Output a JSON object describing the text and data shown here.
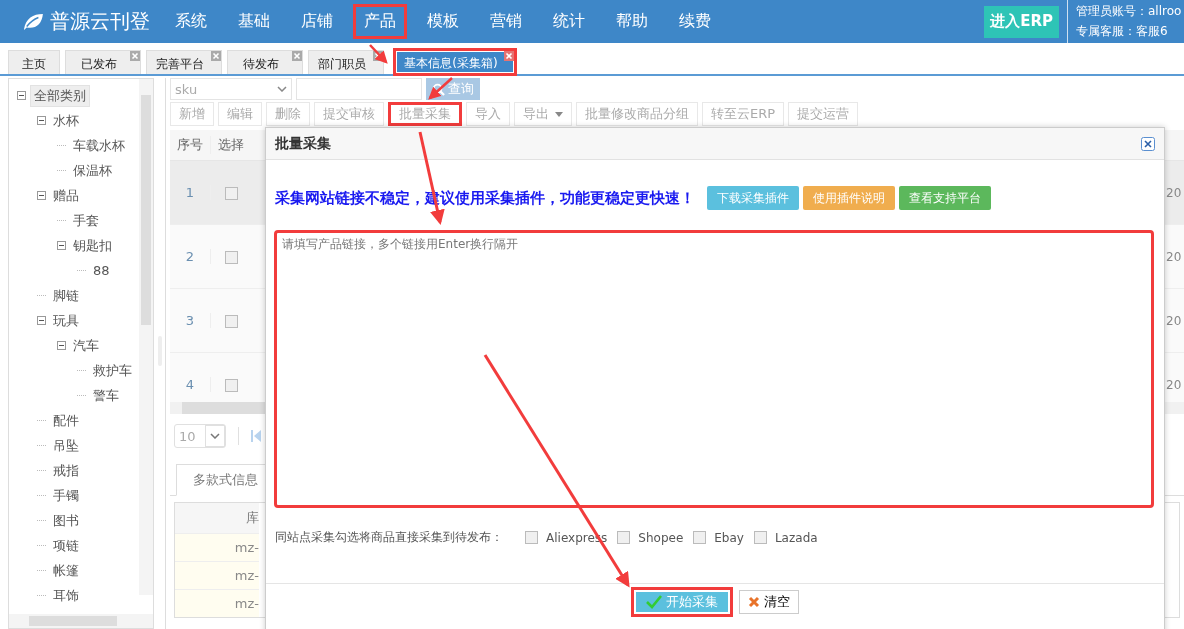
{
  "header": {
    "logo": "普源云刊登",
    "nav": [
      {
        "label": "系统",
        "highlighted": false
      },
      {
        "label": "基础",
        "highlighted": false
      },
      {
        "label": "店铺",
        "highlighted": false
      },
      {
        "label": "产品",
        "highlighted": true
      },
      {
        "label": "模板",
        "highlighted": false
      },
      {
        "label": "营销",
        "highlighted": false
      },
      {
        "label": "统计",
        "highlighted": false
      },
      {
        "label": "帮助",
        "highlighted": false
      },
      {
        "label": "续费",
        "highlighted": false
      }
    ],
    "erp_button": "进入ERP",
    "account": "管理员账号：allroo",
    "support": "专属客服：客服6"
  },
  "tabs": [
    {
      "label": "主页",
      "selected": false,
      "closable": false,
      "highlighted": false
    },
    {
      "label": "已发布",
      "selected": false,
      "closable": true,
      "highlighted": false
    },
    {
      "label": "完善平台",
      "selected": false,
      "closable": true,
      "highlighted": false
    },
    {
      "label": "待发布",
      "selected": false,
      "closable": true,
      "highlighted": false
    },
    {
      "label": "部门职员",
      "selected": false,
      "closable": true,
      "highlighted": false
    },
    {
      "label": "基本信息(采集箱)",
      "selected": true,
      "closable": true,
      "highlighted": true
    }
  ],
  "tree": [
    {
      "label": "全部类别",
      "selected": true,
      "expanded": true,
      "children": [
        {
          "label": "水杯",
          "selected": false,
          "expanded": true,
          "children": [
            {
              "label": "车载水杯",
              "selected": false
            },
            {
              "label": "保温杯",
              "selected": false
            }
          ]
        },
        {
          "label": "赠品",
          "selected": false,
          "expanded": true,
          "children": [
            {
              "label": "手套",
              "selected": false
            },
            {
              "label": "钥匙扣",
              "selected": false,
              "expanded": true,
              "children": [
                {
                  "label": "88",
                  "selected": false
                }
              ]
            }
          ]
        },
        {
          "label": "脚链",
          "selected": false
        },
        {
          "label": "玩具",
          "selected": false,
          "expanded": true,
          "children": [
            {
              "label": "汽车",
              "selected": false,
              "expanded": true,
              "children": [
                {
                  "label": "救护车",
                  "selected": false
                },
                {
                  "label": "警车",
                  "selected": false
                }
              ]
            }
          ]
        },
        {
          "label": "配件",
          "selected": false
        },
        {
          "label": "吊坠",
          "selected": false
        },
        {
          "label": "戒指",
          "selected": false
        },
        {
          "label": "手镯",
          "selected": false
        },
        {
          "label": "图书",
          "selected": false
        },
        {
          "label": "项链",
          "selected": false
        },
        {
          "label": "帐篷",
          "selected": false
        },
        {
          "label": "耳饰",
          "selected": false
        }
      ]
    }
  ],
  "search": {
    "field": "sku",
    "button": "查询"
  },
  "toolbar": [
    {
      "label": "新增",
      "highlighted": false,
      "dropdown": false
    },
    {
      "label": "编辑",
      "highlighted": false,
      "dropdown": false
    },
    {
      "label": "删除",
      "highlighted": false,
      "dropdown": false
    },
    {
      "label": "提交审核",
      "highlighted": false,
      "dropdown": false
    },
    {
      "label": "批量采集",
      "highlighted": true,
      "dropdown": false
    },
    {
      "label": "导入",
      "highlighted": false,
      "dropdown": false
    },
    {
      "label": "导出",
      "highlighted": false,
      "dropdown": true
    },
    {
      "label": "批量修改商品分组",
      "highlighted": false,
      "dropdown": false
    },
    {
      "label": "转至云ERP",
      "highlighted": false,
      "dropdown": false
    },
    {
      "label": "提交运营",
      "highlighted": false,
      "dropdown": false
    }
  ],
  "table": {
    "columns": [
      "序号",
      "选择"
    ],
    "rows": [
      {
        "index": "1",
        "checked": false,
        "selected": true,
        "column_3": "20"
      },
      {
        "index": "2",
        "checked": false,
        "selected": false,
        "column_3": "20"
      },
      {
        "index": "3",
        "checked": false,
        "selected": false,
        "column_3": "20"
      },
      {
        "index": "4",
        "checked": false,
        "selected": false,
        "column_3": "20"
      }
    ]
  },
  "pager": {
    "page_size": "10"
  },
  "detail_tabs": [
    {
      "label": "多款式信息",
      "selected": true
    }
  ],
  "detail_table": {
    "columns": [
      "库"
    ],
    "rows": [
      "mz-",
      "mz-",
      "mz-"
    ]
  },
  "dialog": {
    "title": "批量采集",
    "notice": "采集网站链接不稳定，建议使用采集插件，功能更稳定更快速！",
    "actions": [
      {
        "label": "下载采集插件",
        "color": "#5bc0de"
      },
      {
        "label": "使用插件说明",
        "color": "#f0ad4e"
      },
      {
        "label": "查看支持平台",
        "color": "#5cb85c"
      }
    ],
    "links": {
      "placeholder": "请填写产品链接，多个链接用Enter换行隔开",
      "highlighted": true
    },
    "sites_label": "同站点采集勾选将商品直接采集到待发布：",
    "sites": [
      {
        "label": "Aliexpress",
        "checked": false
      },
      {
        "label": "Shopee",
        "checked": false
      },
      {
        "label": "Ebay",
        "checked": false
      },
      {
        "label": "Lazada",
        "checked": false
      }
    ],
    "start_button": {
      "label": "开始采集",
      "highlighted": true
    },
    "clear_button": "清空"
  },
  "callout_arrows": true
}
